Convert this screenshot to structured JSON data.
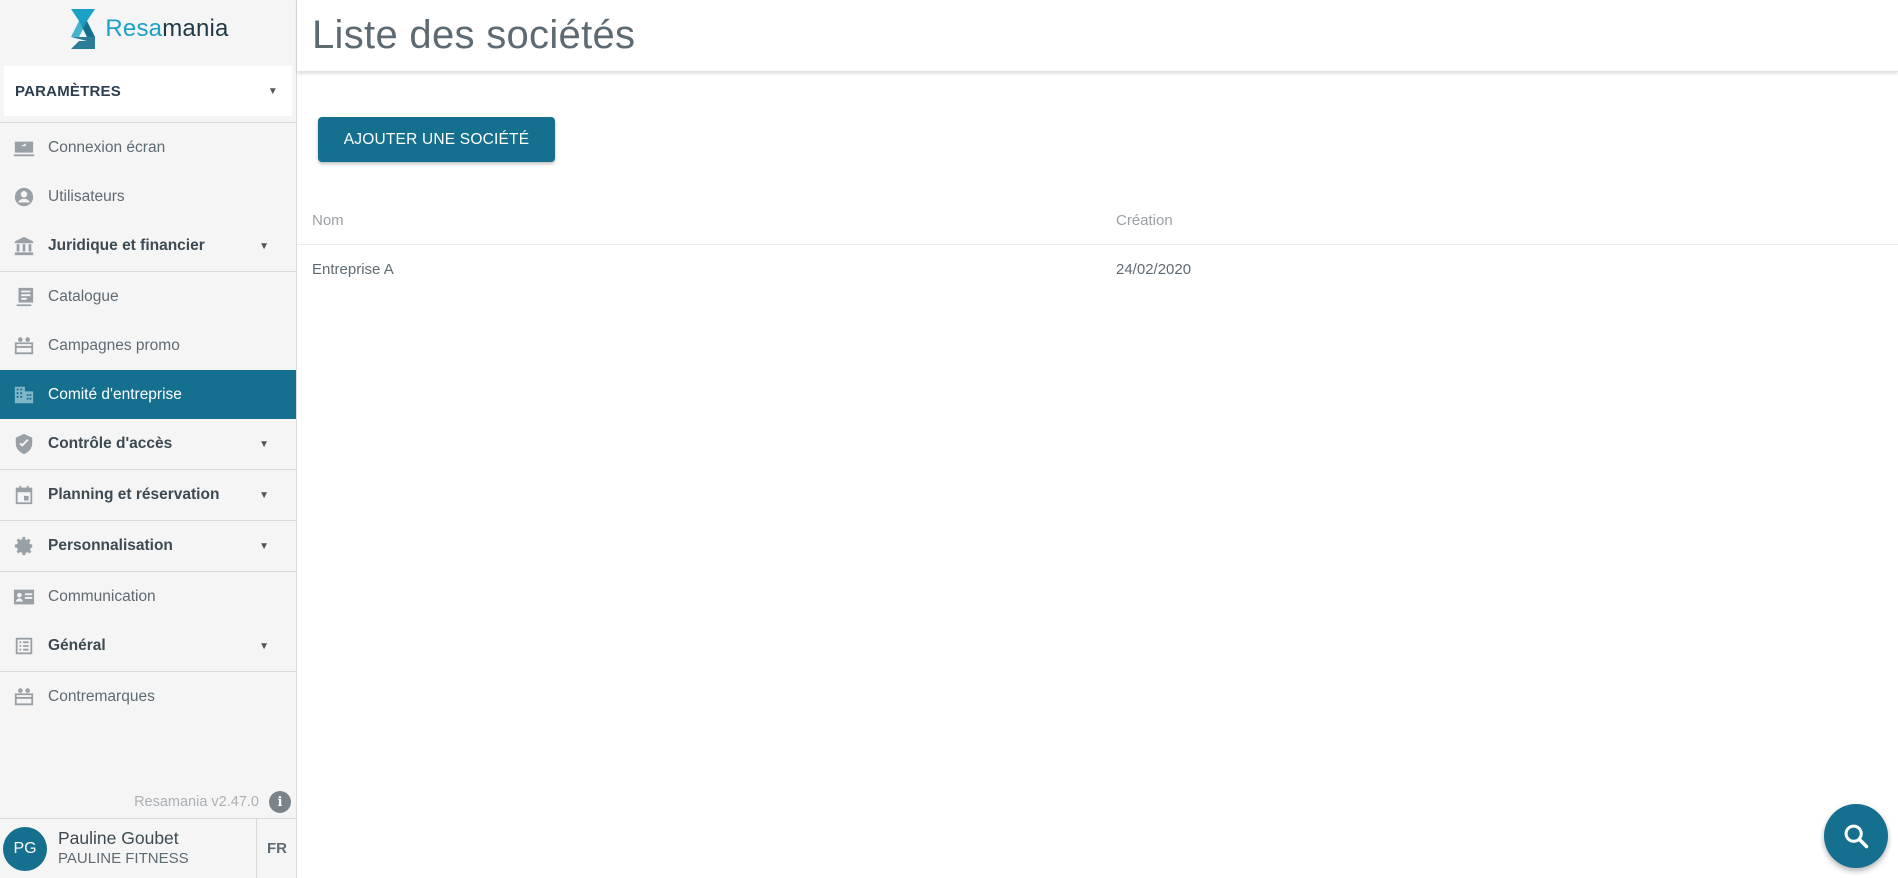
{
  "brand": {
    "name_accent": "Resa",
    "name_rest": "mania"
  },
  "section_select": {
    "value": "PARAMÈTRES"
  },
  "menu": [
    {
      "label": "Connexion écran",
      "icon": "screen-share-icon"
    },
    {
      "label": "Utilisateurs",
      "icon": "user-circle-icon"
    },
    {
      "label": "Juridique et financier",
      "icon": "bank-icon",
      "group": true
    },
    {
      "label": "Catalogue",
      "icon": "catalog-icon"
    },
    {
      "label": "Campagnes promo",
      "icon": "gift-card-icon"
    },
    {
      "label": "Comité d'entreprise",
      "icon": "building-icon",
      "active": true
    },
    {
      "label": "Contrôle d'accès",
      "icon": "shield-check-icon",
      "group": true
    },
    {
      "label": "Planning et réservation",
      "icon": "calendar-icon",
      "group": true
    },
    {
      "label": "Personnalisation",
      "icon": "gear-icon",
      "group": true
    },
    {
      "label": "Communication",
      "icon": "contact-card-icon"
    },
    {
      "label": "Général",
      "icon": "list-icon",
      "group": true
    },
    {
      "label": "Contremarques",
      "icon": "gift-card-icon"
    }
  ],
  "version": {
    "text": "Resamania v2.47.0",
    "info_glyph": "i"
  },
  "user": {
    "initials": "PG",
    "name": "Pauline Goubet",
    "org": "PAULINE FITNESS",
    "lang": "FR"
  },
  "page": {
    "title": "Liste des sociétés",
    "add_button": "AJOUTER UNE SOCIÉTÉ"
  },
  "table": {
    "columns": [
      "Nom",
      "Création"
    ],
    "rows": [
      [
        "Entreprise A",
        "24/02/2020"
      ]
    ]
  },
  "colors": {
    "primary": "#156f8e",
    "brand_accent": "#1aa2c6"
  }
}
